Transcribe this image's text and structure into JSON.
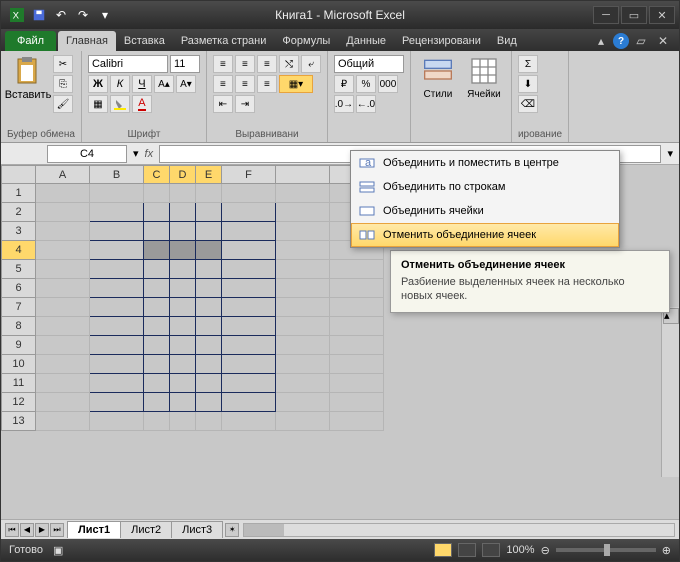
{
  "title": "Книга1 - Microsoft Excel",
  "file_tab": "Файл",
  "tabs": [
    "Главная",
    "Вставка",
    "Разметка страни",
    "Формулы",
    "Данные",
    "Рецензировани",
    "Вид"
  ],
  "active_tab": 0,
  "groups": {
    "clipboard": {
      "label": "Буфер обмена",
      "paste": "Вставить"
    },
    "font": {
      "label": "Шрифт",
      "family": "Calibri",
      "size": "11"
    },
    "alignment": {
      "label": "Выравнивани"
    },
    "number": {
      "label": "",
      "format": "Общий"
    },
    "styles": {
      "styles_label": "Стили",
      "cells_label": "Ячейки"
    },
    "editing": {
      "label": "ирование"
    }
  },
  "namebox": "C4",
  "columns": [
    "A",
    "B",
    "C",
    "D",
    "E",
    "F",
    "",
    ""
  ],
  "selected_cols": [
    "C",
    "D",
    "E"
  ],
  "rows": [
    1,
    2,
    3,
    4,
    5,
    6,
    7,
    8,
    9,
    10,
    11,
    12,
    13
  ],
  "selected_row": 4,
  "bordered_range": {
    "r1": 2,
    "r2": 12,
    "c1": 1,
    "c2": 5
  },
  "merge_menu": [
    "Объединить и поместить в центре",
    "Объединить по строкам",
    "Объединить ячейки",
    "Отменить объединение ячеек"
  ],
  "merge_hover_index": 3,
  "tooltip": {
    "title": "Отменить объединение ячеек",
    "body": "Разбиение выделенных ячеек на несколько новых ячеек."
  },
  "sheets": [
    "Лист1",
    "Лист2",
    "Лист3"
  ],
  "active_sheet": 0,
  "status": {
    "ready": "Готово",
    "zoom": "100%"
  }
}
